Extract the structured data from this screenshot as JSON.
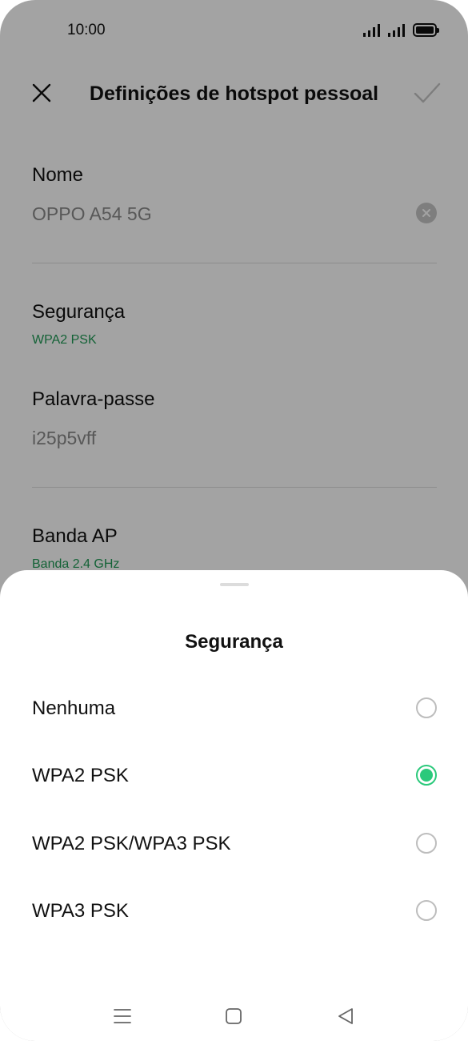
{
  "status_bar": {
    "time": "10:00",
    "icons": [
      "signal-icon",
      "signal-icon",
      "battery-icon"
    ]
  },
  "header": {
    "title": "Definições de hotspot pessoal",
    "close_icon": "close-icon",
    "confirm_icon": "check-icon"
  },
  "settings": {
    "name_label": "Nome",
    "name_value": "OPPO A54 5G",
    "security_label": "Segurança",
    "security_value": "WPA2 PSK",
    "password_label": "Palavra-passe",
    "password_value": "i25p5vff",
    "band_label": "Banda AP",
    "band_value": "Banda 2.4 GHz"
  },
  "sheet": {
    "title": "Segurança",
    "options": [
      {
        "label": "Nenhuma",
        "selected": false
      },
      {
        "label": "WPA2 PSK",
        "selected": true
      },
      {
        "label": "WPA2 PSK/WPA3 PSK",
        "selected": false
      },
      {
        "label": "WPA3 PSK",
        "selected": false
      }
    ]
  },
  "nav": {
    "icons": [
      "menu-icon",
      "home-icon",
      "back-icon"
    ]
  },
  "colors": {
    "accent": "#1f9a55",
    "radio_selected": "#2bc97b"
  }
}
